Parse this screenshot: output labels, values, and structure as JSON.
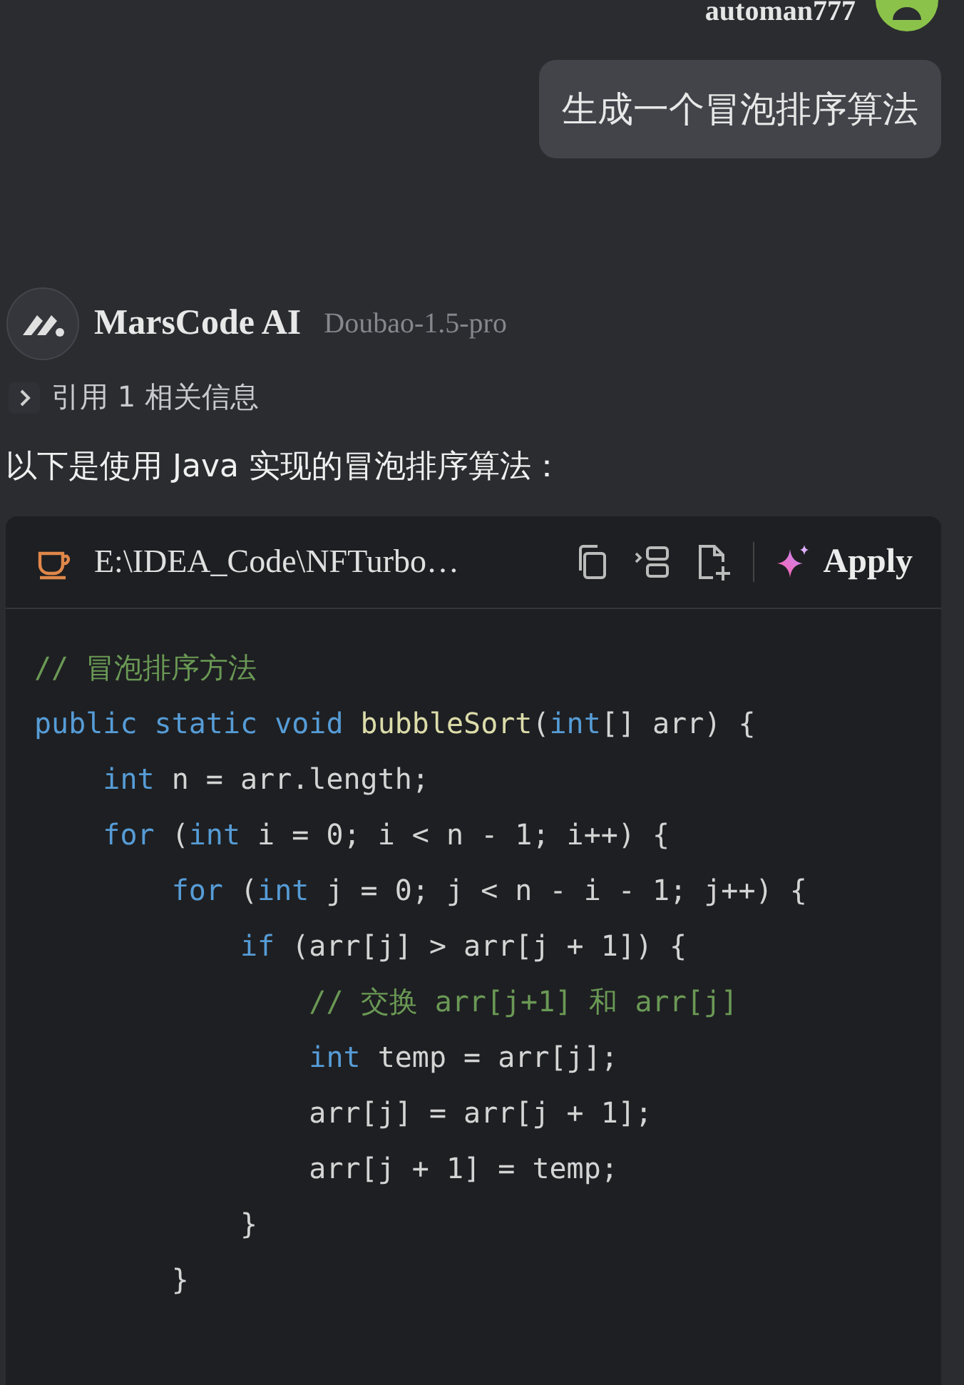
{
  "user": {
    "name": "automan777",
    "message": "生成一个冒泡排序算法"
  },
  "assistant": {
    "name": "MarsCode AI",
    "model": "Doubao-1.5-pro",
    "reference": {
      "label": "引用 1 相关信息",
      "expanded": false
    },
    "intro": "以下是使用 Java 实现的冒泡排序算法："
  },
  "code_block": {
    "file": "E:\\IDEA_Code\\NFTurbo…",
    "apply": "Apply",
    "lines": [
      [
        {
          "kind": "comment",
          "text": "// 冒泡排序方法"
        }
      ],
      [
        {
          "kind": "keyword",
          "text": "public static void "
        },
        {
          "kind": "function",
          "text": "bubbleSort"
        },
        {
          "kind": "plain",
          "text": "("
        },
        {
          "kind": "keyword",
          "text": "int"
        },
        {
          "kind": "plain",
          "text": "[] arr) {"
        }
      ],
      [
        {
          "kind": "keyword",
          "text": "    int"
        },
        {
          "kind": "plain",
          "text": " n = arr.length;"
        }
      ],
      [
        {
          "kind": "keyword",
          "text": "    for"
        },
        {
          "kind": "plain",
          "text": " ("
        },
        {
          "kind": "keyword",
          "text": "int"
        },
        {
          "kind": "plain",
          "text": " i = 0; i < n - 1; i++) {"
        }
      ],
      [
        {
          "kind": "keyword",
          "text": "        for"
        },
        {
          "kind": "plain",
          "text": " ("
        },
        {
          "kind": "keyword",
          "text": "int"
        },
        {
          "kind": "plain",
          "text": " j = 0; j < n - i - 1; j++) {"
        }
      ],
      [
        {
          "kind": "keyword",
          "text": "            if"
        },
        {
          "kind": "plain",
          "text": " (arr[j] > arr[j + 1]) {"
        }
      ],
      [
        {
          "kind": "comment",
          "text": "                // 交换 arr[j+1] 和 arr[j]"
        }
      ],
      [
        {
          "kind": "keyword",
          "text": "                int"
        },
        {
          "kind": "plain",
          "text": " temp = arr[j];"
        }
      ],
      [
        {
          "kind": "plain",
          "text": "                arr[j] = arr[j + 1];"
        }
      ],
      [
        {
          "kind": "plain",
          "text": "                arr[j + 1] = temp;"
        }
      ],
      [
        {
          "kind": "plain",
          "text": "            }"
        }
      ],
      [
        {
          "kind": "plain",
          "text": "        }"
        }
      ]
    ]
  }
}
